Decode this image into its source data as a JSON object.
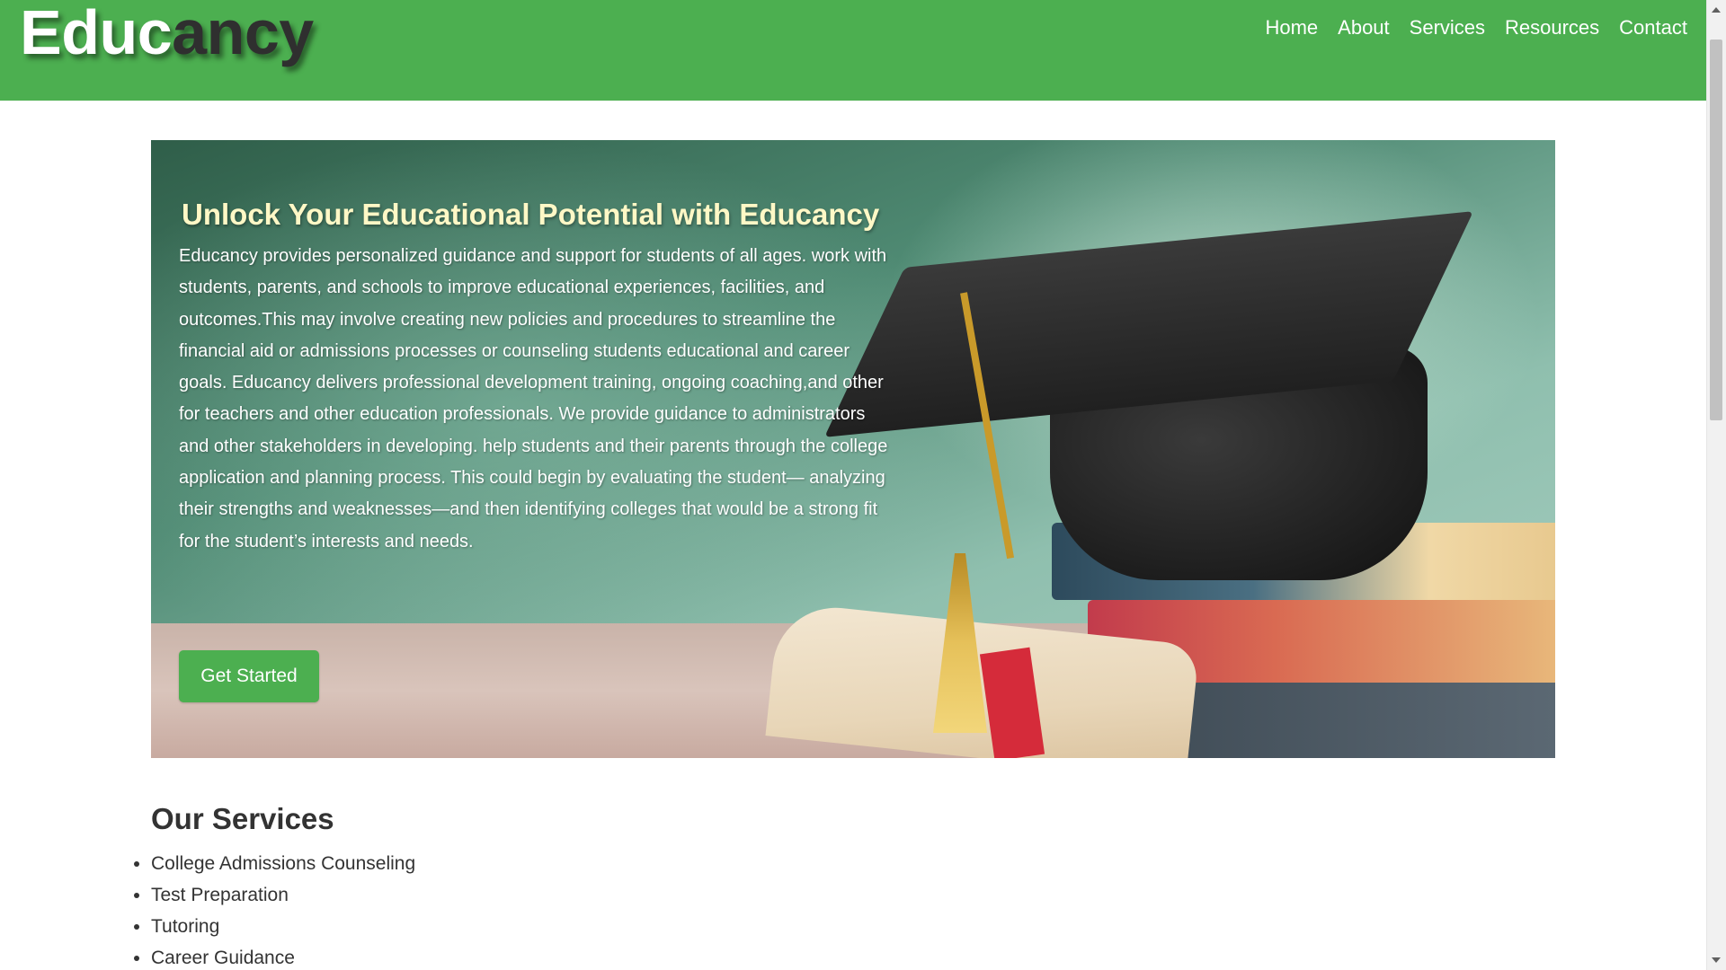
{
  "header": {
    "logo_part1": "Educ",
    "logo_part2": "ancy",
    "nav": [
      {
        "label": "Home"
      },
      {
        "label": "About"
      },
      {
        "label": "Services"
      },
      {
        "label": "Resources"
      },
      {
        "label": "Contact"
      }
    ]
  },
  "hero": {
    "title": "Unlock Your Educational Potential with Educancy",
    "text": "Educancy provides personalized guidance and support for students of all ages. work with students, parents, and schools to improve educational experiences, facilities, and outcomes.This may involve creating new policies and procedures to streamline the financial aid or admissions processes or counseling students educational and career goals. Educancy delivers professional development training, ongoing coaching,and other for teachers and other education professionals. We provide guidance to administrators and other stakeholders in developing. help students and their parents through the college application and planning process. This could begin by evaluating the student— analyzing their strengths and weaknesses—and then identifying colleges that would be a strong fit for the student’s interests and needs.",
    "cta_label": "Get Started",
    "image_icon": "graduation-cap-books-diploma"
  },
  "services": {
    "title": "Our Services",
    "items": [
      {
        "label": "College Admissions Counseling"
      },
      {
        "label": "Test Preparation"
      },
      {
        "label": "Tutoring"
      },
      {
        "label": "Career Guidance"
      }
    ]
  },
  "colors": {
    "brand_green": "#4caf50",
    "hero_title": "#fff8c6",
    "text_dark": "#333333"
  }
}
